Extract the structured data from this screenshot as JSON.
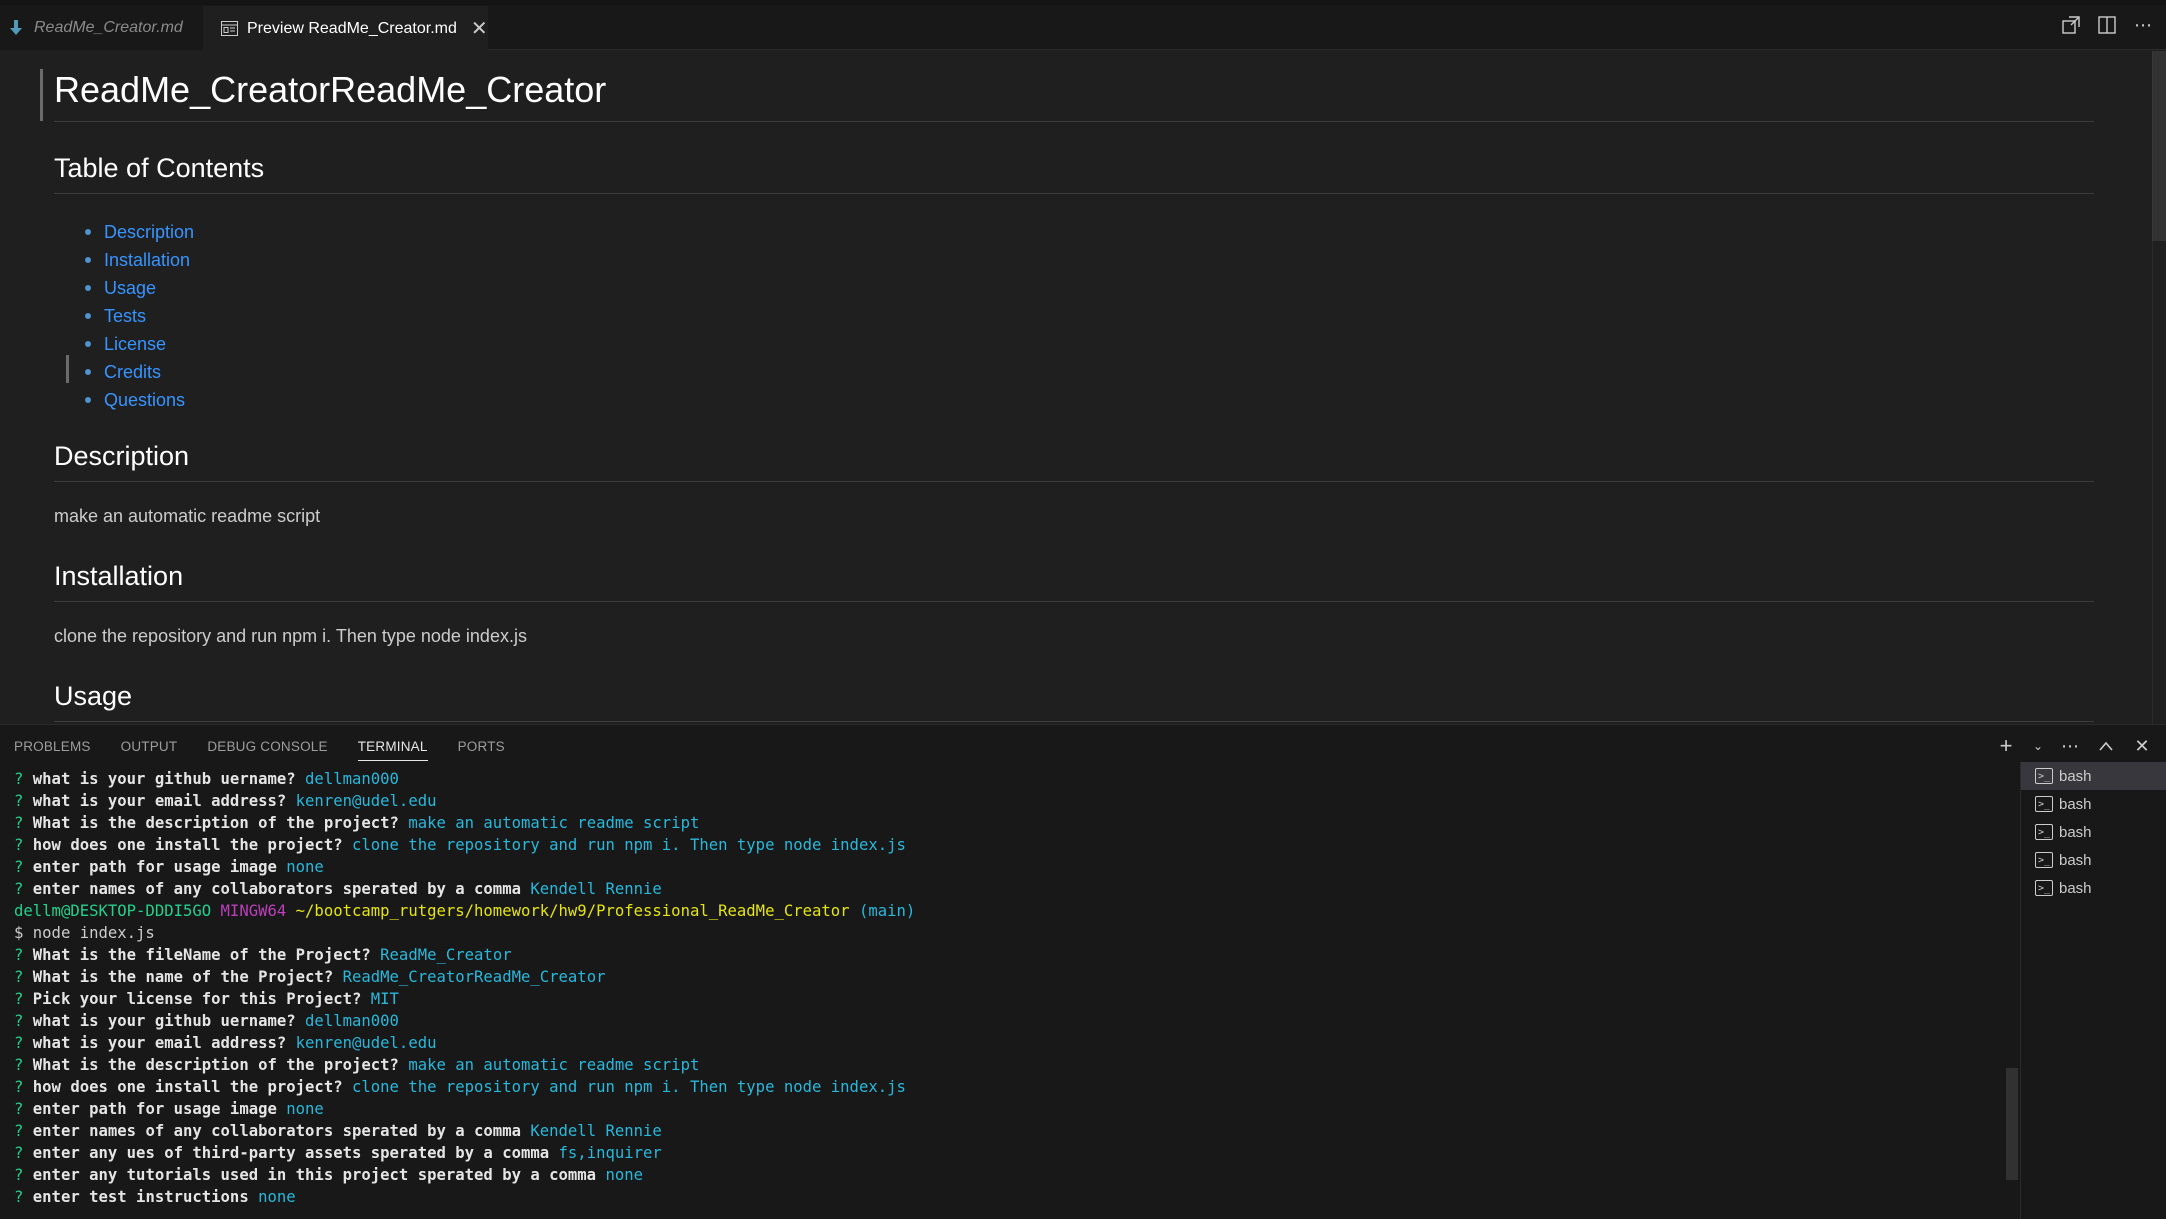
{
  "tabs": [
    {
      "label": "ReadMe_Creator.md",
      "active": false
    },
    {
      "label": "Preview ReadMe_Creator.md",
      "active": true
    }
  ],
  "editor_actions": [
    "open-source-icon",
    "split-editor-icon",
    "more-actions-icon"
  ],
  "preview": {
    "title": "ReadMe_CreatorReadMe_Creator",
    "toc_heading": "Table of Contents",
    "toc": [
      "Description",
      "Installation",
      "Usage",
      "Tests",
      "License",
      "Credits",
      "Questions"
    ],
    "description_heading": "Description",
    "description_text": "make an automatic readme script",
    "installation_heading": "Installation",
    "installation_text": "clone the repository and run npm i. Then type node index.js",
    "usage_heading": "Usage"
  },
  "panel": {
    "tabs": [
      "PROBLEMS",
      "OUTPUT",
      "DEBUG CONSOLE",
      "TERMINAL",
      "PORTS"
    ],
    "active_tab": "TERMINAL",
    "terminals": [
      "bash",
      "bash",
      "bash",
      "bash",
      "bash"
    ]
  },
  "terminal_lines": [
    {
      "type": "qa",
      "q": "what is your github uername?",
      "a": "dellman000"
    },
    {
      "type": "qa",
      "q": "what is your email address?",
      "a": "kenren@udel.edu"
    },
    {
      "type": "qa",
      "q": "What is the description of the project?",
      "a": "make an automatic readme script"
    },
    {
      "type": "qa",
      "q": "how does one install the project?",
      "a": "clone the repository and run npm i. Then type node index.js"
    },
    {
      "type": "qa",
      "q": "enter path for usage image",
      "a": "none"
    },
    {
      "type": "qa",
      "q": "enter names of any collaborators sperated by a comma",
      "a": "Kendell Rennie"
    },
    {
      "type": "prompt",
      "user": "dellm@DESKTOP-DDDI5GO",
      "sys": "MINGW64",
      "path": "~/bootcamp_rutgers/homework/hw9/Professional_ReadMe_Creator",
      "branch": "(main)"
    },
    {
      "type": "cmd",
      "text": "$ node index.js"
    },
    {
      "type": "qa",
      "q": "What is the fileName of the Project?",
      "a": "ReadMe_Creator"
    },
    {
      "type": "qa",
      "q": "What is the name of the Project?",
      "a": "ReadMe_CreatorReadMe_Creator"
    },
    {
      "type": "qa",
      "q": "Pick your license for this Project?",
      "a": "MIT"
    },
    {
      "type": "qa",
      "q": "what is your github uername?",
      "a": "dellman000"
    },
    {
      "type": "qa",
      "q": "what is your email address?",
      "a": "kenren@udel.edu"
    },
    {
      "type": "qa",
      "q": "What is the description of the project?",
      "a": "make an automatic readme script"
    },
    {
      "type": "qa",
      "q": "how does one install the project?",
      "a": "clone the repository and run npm i. Then type node index.js"
    },
    {
      "type": "qa",
      "q": "enter path for usage image",
      "a": "none"
    },
    {
      "type": "qa",
      "q": "enter names of any collaborators sperated by a comma",
      "a": "Kendell Rennie"
    },
    {
      "type": "qa",
      "q": "enter any ues of third-party assets sperated by a comma",
      "a": "fs,inquirer"
    },
    {
      "type": "qa",
      "q": "enter any tutorials used in this project sperated by a comma",
      "a": "none"
    },
    {
      "type": "qa",
      "q": "enter test instructions",
      "a": "none"
    }
  ]
}
